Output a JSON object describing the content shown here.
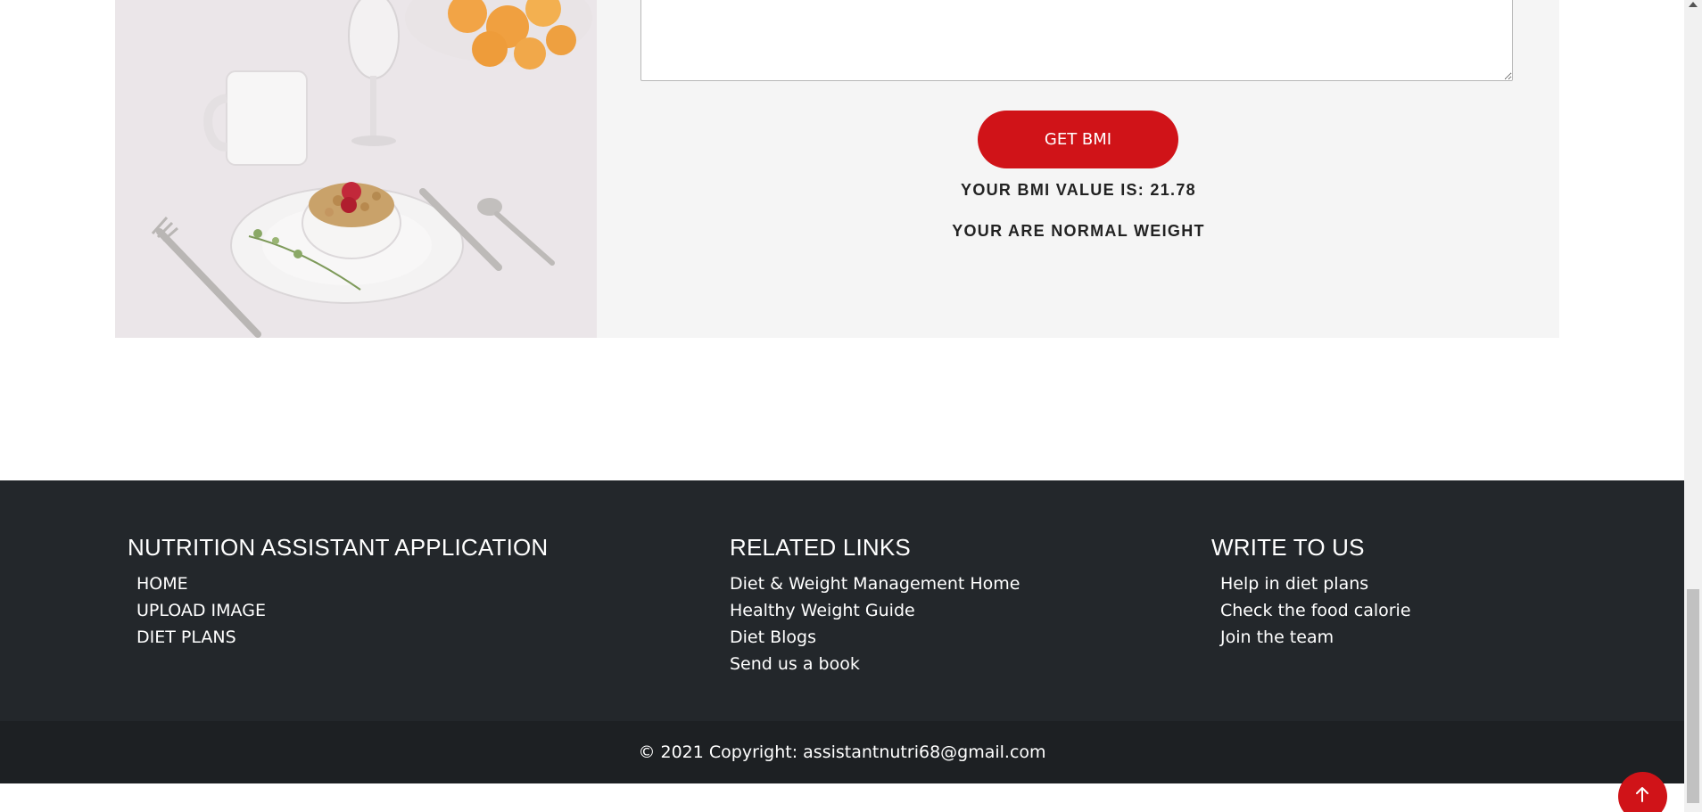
{
  "bmi": {
    "button_label": "GET BMI",
    "value_text": "YOUR BMI VALUE IS: 21.78",
    "status_text": "YOUR ARE NORMAL WEIGHT",
    "notes_value": ""
  },
  "footer": {
    "columns": [
      {
        "title": "NUTRITION ASSISTANT APPLICATION",
        "links": [
          "HOME",
          "UPLOAD IMAGE",
          "DIET PLANS"
        ]
      },
      {
        "title": "RELATED LINKS",
        "links": [
          "Diet & Weight Management Home",
          "Healthy Weight Guide",
          "Diet Blogs",
          "Send us a book"
        ]
      },
      {
        "title": "WRITE TO US",
        "links": [
          "Help in diet plans",
          "Check the food calorie",
          "Join the team"
        ]
      }
    ],
    "copyright": "© 2021 Copyright: assistantnutri68@gmail.com"
  },
  "icons": {
    "back_to_top": "arrow-up-icon"
  },
  "colors": {
    "accent": "#d01318",
    "footer_bg": "#23272b",
    "copyright_bg": "#1d2023",
    "section_bg": "#f5f5f5"
  }
}
